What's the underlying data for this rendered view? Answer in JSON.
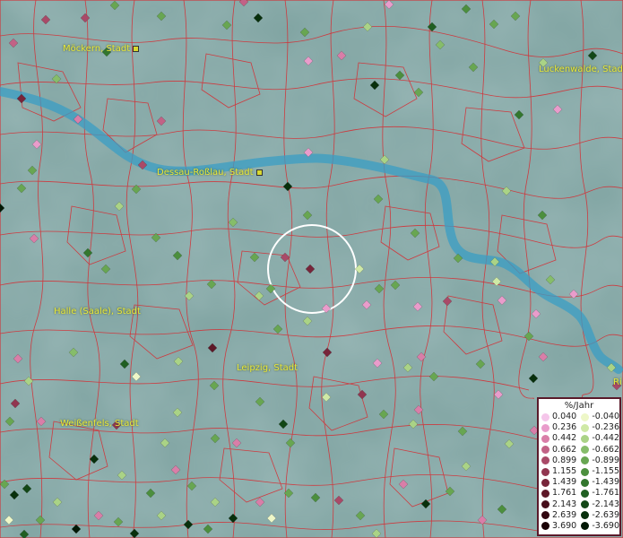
{
  "towns": [
    {
      "name": "Möckern, Stadt"
    },
    {
      "name": "Luckenwalde, Stadt"
    },
    {
      "name": "Dessau-Roßlau, Stadt"
    },
    {
      "name": "Halle (Saale), Stadt"
    },
    {
      "name": "Leipzig, Stadt"
    },
    {
      "name": "Weißenfels, Stadt"
    },
    {
      "name": "Ri"
    }
  ],
  "legend": {
    "title": "%/Jahr",
    "positive": [
      {
        "label": "0.040",
        "color": "#f5c6ea"
      },
      {
        "label": "0.236",
        "color": "#e99ccb"
      },
      {
        "label": "0.442",
        "color": "#d97ea8"
      },
      {
        "label": "0.662",
        "color": "#c26286"
      },
      {
        "label": "0.899",
        "color": "#a94a68"
      },
      {
        "label": "1.155",
        "color": "#913650"
      },
      {
        "label": "1.439",
        "color": "#77253a"
      },
      {
        "label": "1.761",
        "color": "#5e1828"
      },
      {
        "label": "2.143",
        "color": "#470e1b"
      },
      {
        "label": "2.639",
        "color": "#320710"
      },
      {
        "label": "3.690",
        "color": "#1a0206"
      }
    ],
    "negative": [
      {
        "label": "-0.040",
        "color": "#eef7c8"
      },
      {
        "label": "-0.236",
        "color": "#cfe9a6"
      },
      {
        "label": "-0.442",
        "color": "#aad386"
      },
      {
        "label": "-0.662",
        "color": "#86bd6a"
      },
      {
        "label": "-0.899",
        "color": "#68a652"
      },
      {
        "label": "-1.155",
        "color": "#4c8f3e"
      },
      {
        "label": "-1.439",
        "color": "#33772e"
      },
      {
        "label": "-1.761",
        "color": "#205f22"
      },
      {
        "label": "-2.143",
        "color": "#124716"
      },
      {
        "label": "-2.639",
        "color": "#08300c"
      },
      {
        "label": "-3.690",
        "color": "#021805"
      }
    ]
  },
  "colors": {
    "terrain": "#7fa3a1",
    "river": "#3a9ec4",
    "boundary": "#d8282e",
    "selection_ring": "#ffffff",
    "legend_border": "#5a1a2a"
  }
}
